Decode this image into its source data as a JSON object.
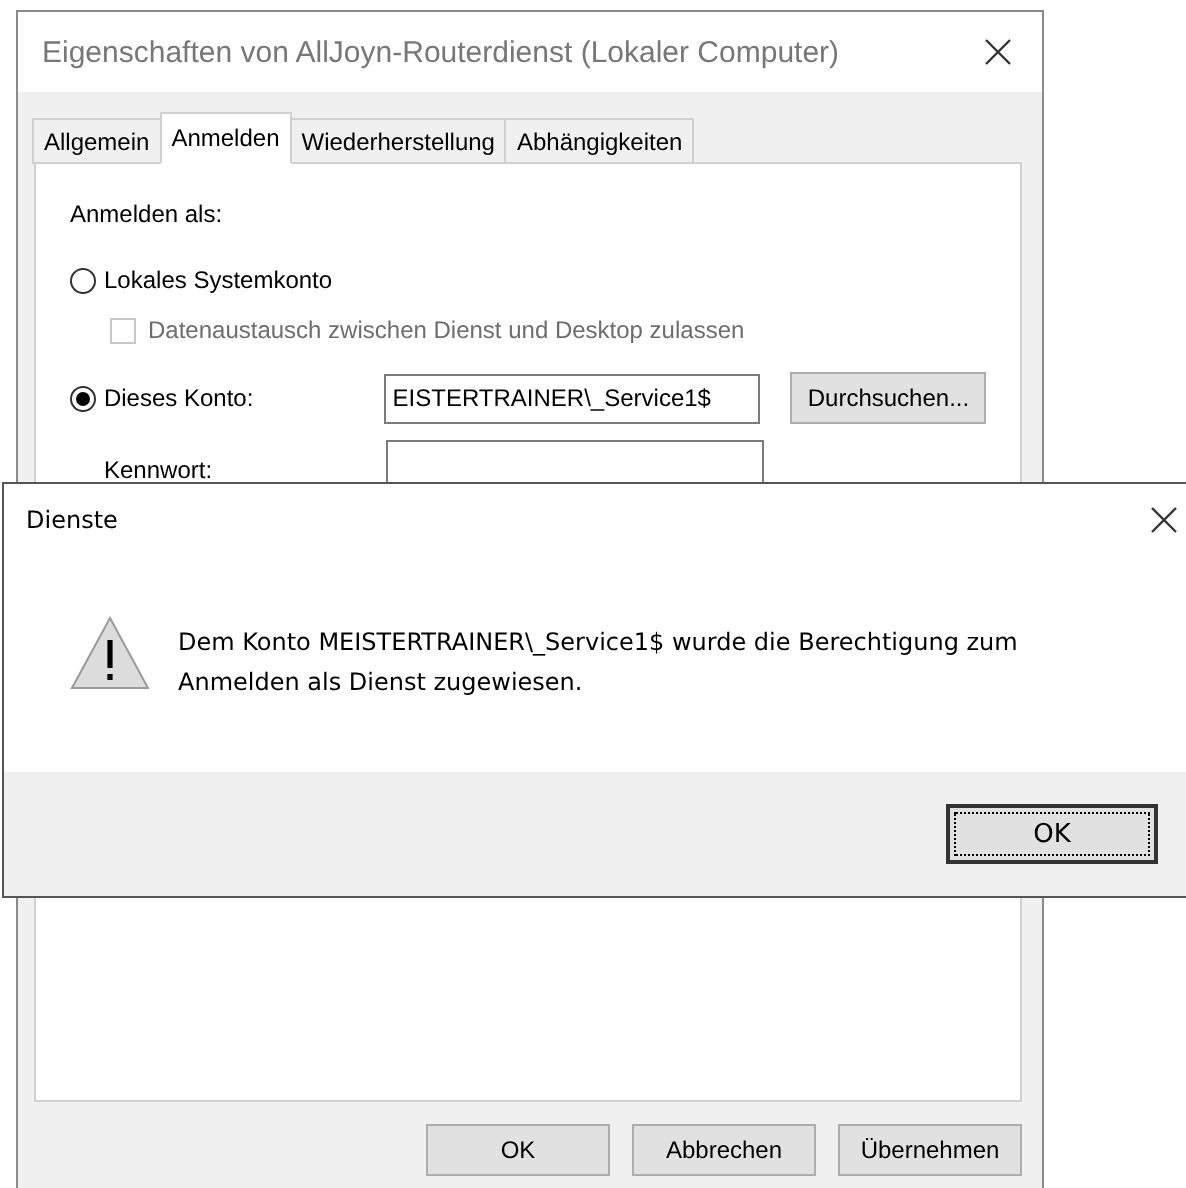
{
  "back_window": {
    "title": "Eigenschaften von AllJoyn-Routerdienst (Lokaler Computer)",
    "tabs": [
      {
        "label": "Allgemein",
        "selected": false
      },
      {
        "label": "Anmelden",
        "selected": true
      },
      {
        "label": "Wiederherstellung",
        "selected": false
      },
      {
        "label": "Abhängigkeiten",
        "selected": false
      }
    ],
    "logon_label": "Anmelden als:",
    "options": [
      {
        "label": "Lokales Systemkonto",
        "selected": false
      },
      {
        "label": "Dieses Konto:",
        "selected": true
      }
    ],
    "desktop_checkbox": {
      "label": "Datenaustausch zwischen Dienst und Desktop zulassen",
      "checked": false,
      "disabled": true
    },
    "account_value": "EISTERTRAINER\\_Service1$",
    "browse_button": "Durchsuchen...",
    "password_label": "Kennwort:",
    "buttons": [
      "OK",
      "Abbrechen",
      "Übernehmen"
    ]
  },
  "message_box": {
    "title": "Dienste",
    "message": "Dem Konto MEISTERTRAINER\\_Service1$ wurde die Berechtigung zum Anmelden als Dienst zugewiesen.",
    "button": "OK"
  }
}
